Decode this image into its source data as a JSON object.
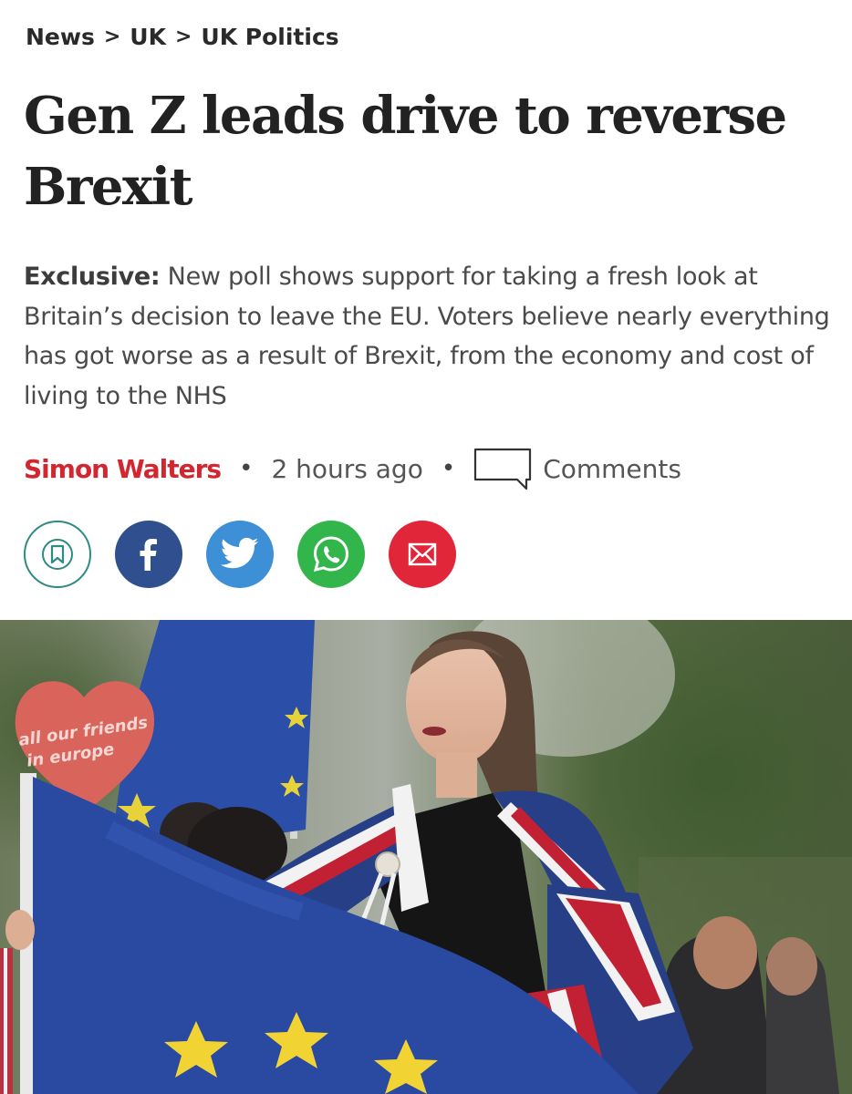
{
  "breadcrumb": {
    "items": [
      "News",
      "UK",
      "UK Politics"
    ],
    "separator": ">"
  },
  "article": {
    "headline": "Gen Z leads drive to reverse Brexit",
    "standfirst_lead": "Exclusive:",
    "standfirst_body": " New poll shows support for taking a fresh look at Britain’s decision to leave the EU. Voters believe nearly everything has got worse as a result of Brexit, from the economy and cost of living to the NHS",
    "author": "Simon Walters",
    "meta_separator": "•",
    "timestamp": "2 hours ago",
    "comments_label": "Comments"
  },
  "share": [
    {
      "name": "bookmark",
      "icon": "bookmark-icon",
      "color": "#2f8a83"
    },
    {
      "name": "facebook",
      "icon": "facebook-icon",
      "color": "#2f4f8f"
    },
    {
      "name": "twitter",
      "icon": "twitter-icon",
      "color": "#3d8fd6"
    },
    {
      "name": "whatsapp",
      "icon": "whatsapp-icon",
      "color": "#32b54a"
    },
    {
      "name": "email",
      "icon": "email-icon",
      "color": "#e2263a"
    }
  ],
  "photo": {
    "sign_text": [
      "all our friends",
      "in europe"
    ]
  },
  "colors": {
    "author": "#d22630",
    "text": "#222222",
    "standfirst": "#4a4a4a"
  }
}
